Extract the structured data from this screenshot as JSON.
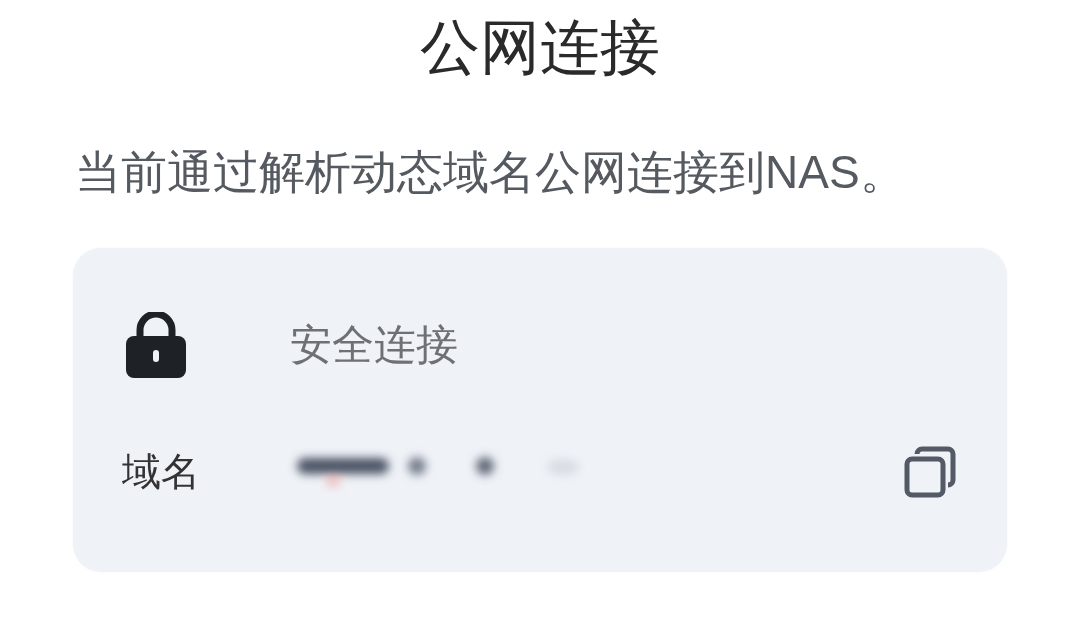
{
  "title": "公网连接",
  "description": "当前通过解析动态域名公网连接到NAS。",
  "card": {
    "rows": [
      {
        "kind": "status",
        "value": "安全连接"
      },
      {
        "kind": "field",
        "label": "域名",
        "redacted": true
      }
    ]
  }
}
